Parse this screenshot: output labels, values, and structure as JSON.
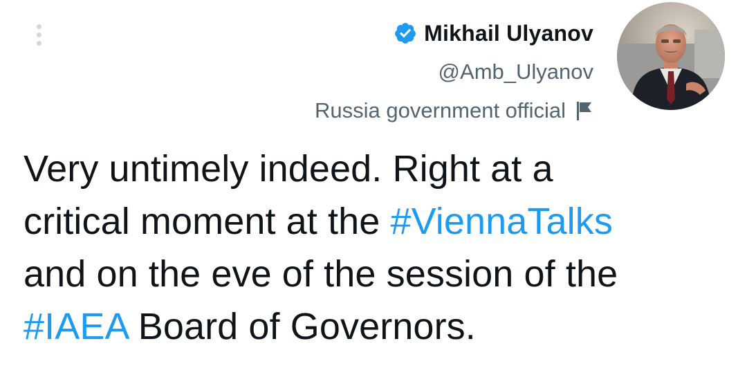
{
  "author": {
    "display_name": "Mikhail Ulyanov",
    "handle": "@Amb_Ulyanov",
    "label": "Russia government official",
    "verified_icon": "verified-badge-icon",
    "label_icon": "flag-icon",
    "avatar_description": "profile-photo"
  },
  "menu": {
    "icon": "more-vertical-icon"
  },
  "tweet": {
    "line1": "Very untimely indeed. Right at a",
    "line2_prefix": "critical moment at the ",
    "hashtag1": "#ViennaTalks",
    "line3": "and on the eve of the session of the",
    "hashtag2": "#IAEA",
    "line4_suffix": " Board of Governors."
  },
  "colors": {
    "text": "#0f1419",
    "secondary": "#536471",
    "accent": "#1d9bf0"
  }
}
